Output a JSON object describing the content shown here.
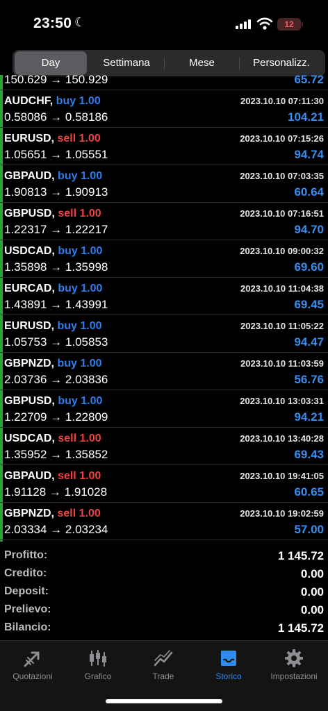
{
  "status_bar": {
    "time": "23:50",
    "battery": "12"
  },
  "segments": [
    {
      "label": "Day",
      "active": true
    },
    {
      "label": "Settimana",
      "active": false
    },
    {
      "label": "Mese",
      "active": false
    },
    {
      "label": "Personalizz.",
      "active": false
    }
  ],
  "partial_row": {
    "prices": "150.629 → 150.929",
    "profit": "65.72"
  },
  "trades": [
    {
      "symbol": "AUDCHF,",
      "side": "buy",
      "lots": "1.00",
      "prices": "0.58086 → 0.58186",
      "date": "2023.10.10 07:11:30",
      "profit": "104.21"
    },
    {
      "symbol": "EURUSD,",
      "side": "sell",
      "lots": "1.00",
      "prices": "1.05651 → 1.05551",
      "date": "2023.10.10 07:15:26",
      "profit": "94.74"
    },
    {
      "symbol": "GBPAUD,",
      "side": "buy",
      "lots": "1.00",
      "prices": "1.90813 → 1.90913",
      "date": "2023.10.10 07:03:35",
      "profit": "60.64"
    },
    {
      "symbol": "GBPUSD,",
      "side": "sell",
      "lots": "1.00",
      "prices": "1.22317 → 1.22217",
      "date": "2023.10.10 07:16:51",
      "profit": "94.70"
    },
    {
      "symbol": "USDCAD,",
      "side": "buy",
      "lots": "1.00",
      "prices": "1.35898 → 1.35998",
      "date": "2023.10.10 09:00:32",
      "profit": "69.60"
    },
    {
      "symbol": "EURCAD,",
      "side": "buy",
      "lots": "1.00",
      "prices": "1.43891 → 1.43991",
      "date": "2023.10.10 11:04:38",
      "profit": "69.45"
    },
    {
      "symbol": "EURUSD,",
      "side": "buy",
      "lots": "1.00",
      "prices": "1.05753 → 1.05853",
      "date": "2023.10.10 11:05:22",
      "profit": "94.47"
    },
    {
      "symbol": "GBPNZD,",
      "side": "buy",
      "lots": "1.00",
      "prices": "2.03736 → 2.03836",
      "date": "2023.10.10 11:03:59",
      "profit": "56.76"
    },
    {
      "symbol": "GBPUSD,",
      "side": "buy",
      "lots": "1.00",
      "prices": "1.22709 → 1.22809",
      "date": "2023.10.10 13:03:31",
      "profit": "94.21"
    },
    {
      "symbol": "USDCAD,",
      "side": "sell",
      "lots": "1.00",
      "prices": "1.35952 → 1.35852",
      "date": "2023.10.10 13:40:28",
      "profit": "69.43"
    },
    {
      "symbol": "GBPAUD,",
      "side": "sell",
      "lots": "1.00",
      "prices": "1.91128 → 1.91028",
      "date": "2023.10.10 19:41:05",
      "profit": "60.65"
    },
    {
      "symbol": "GBPNZD,",
      "side": "sell",
      "lots": "1.00",
      "prices": "2.03334 → 2.03234",
      "date": "2023.10.10 19:02:59",
      "profit": "57.00"
    }
  ],
  "summary": [
    {
      "label": "Profitto:",
      "value": "1 145.72"
    },
    {
      "label": "Credito:",
      "value": "0.00"
    },
    {
      "label": "Deposit:",
      "value": "0.00"
    },
    {
      "label": "Prelievo:",
      "value": "0.00"
    },
    {
      "label": "Bilancio:",
      "value": "1 145.72"
    }
  ],
  "tabs": [
    {
      "label": "Quotazioni",
      "icon": "quotes-icon",
      "active": false
    },
    {
      "label": "Grafico",
      "icon": "candlestick-icon",
      "active": false
    },
    {
      "label": "Trade",
      "icon": "trade-chart-icon",
      "active": false
    },
    {
      "label": "Storico",
      "icon": "inbox-tray-icon",
      "active": true
    },
    {
      "label": "Impostazioni",
      "icon": "gear-icon",
      "active": false
    }
  ],
  "colors": {
    "buy": "#2f7dec",
    "sell": "#f04141",
    "profit": "#3a8df0",
    "accent_bar": "#24a636",
    "active_tab": "#2f8bf0"
  }
}
